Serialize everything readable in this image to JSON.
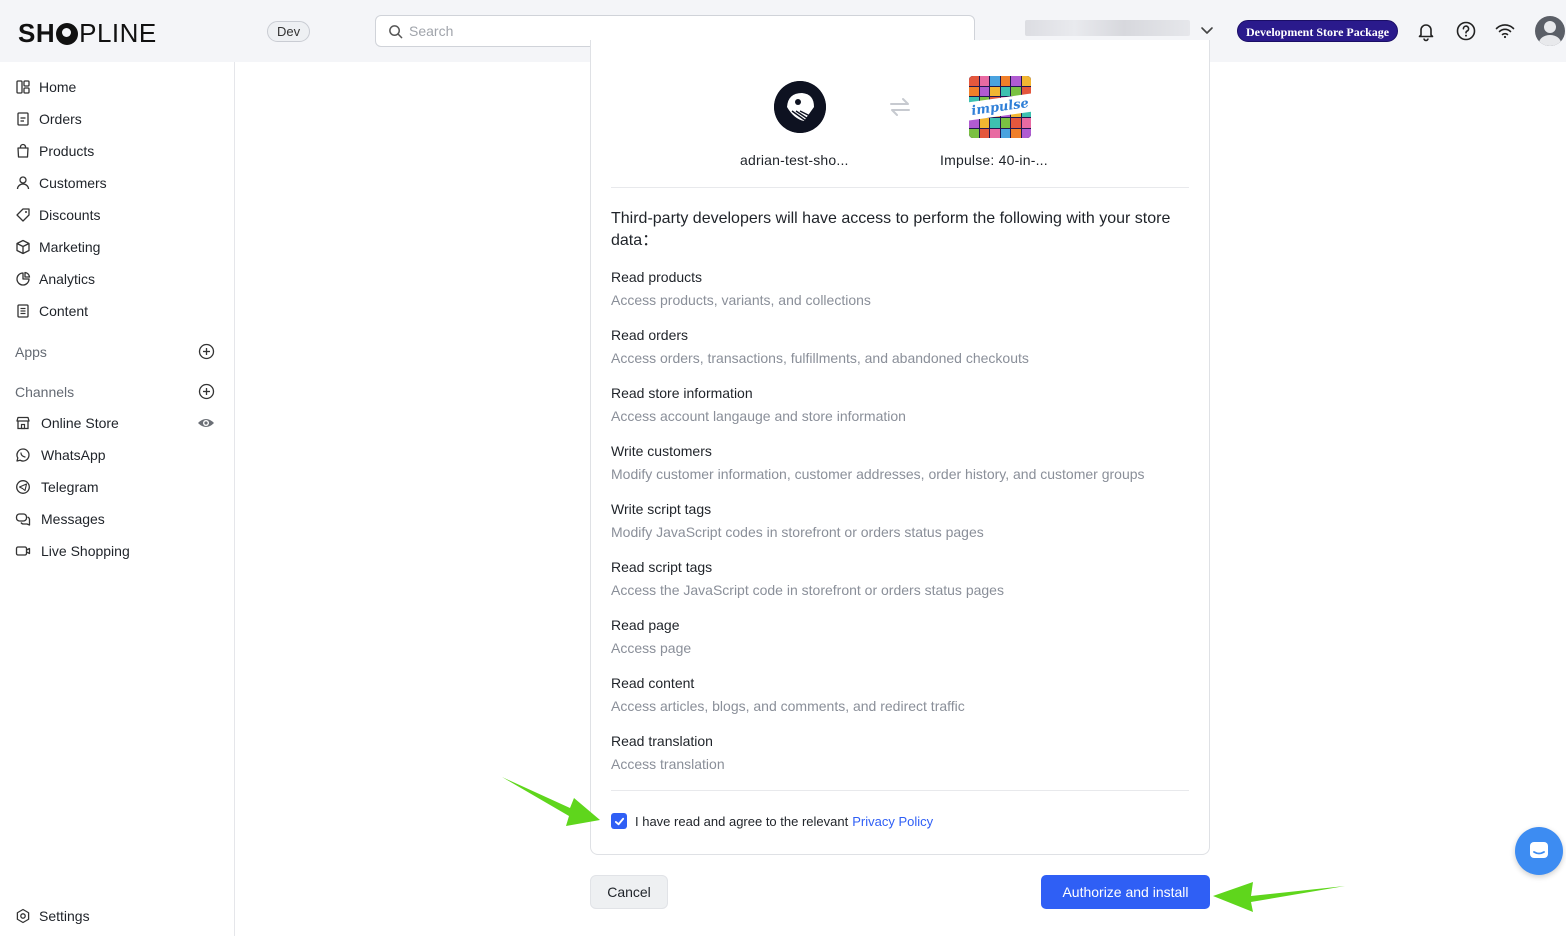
{
  "header": {
    "logo_bold": "SH",
    "logo_rest_bold": "PLINE",
    "env_badge": "Dev",
    "search_placeholder": "Search",
    "package_badge": "Development Store Package"
  },
  "sidebar": {
    "nav": [
      {
        "label": "Home",
        "icon": "home-icon"
      },
      {
        "label": "Orders",
        "icon": "orders-icon"
      },
      {
        "label": "Products",
        "icon": "shopping-bag-icon"
      },
      {
        "label": "Customers",
        "icon": "person-icon"
      },
      {
        "label": "Discounts",
        "icon": "tag-icon"
      },
      {
        "label": "Marketing",
        "icon": "cube-icon"
      },
      {
        "label": "Analytics",
        "icon": "pie-chart-icon"
      },
      {
        "label": "Content",
        "icon": "document-icon"
      }
    ],
    "apps_label": "Apps",
    "channels_label": "Channels",
    "channels": [
      {
        "label": "Online Store",
        "icon": "storefront-icon"
      },
      {
        "label": "WhatsApp",
        "icon": "whatsapp-icon"
      },
      {
        "label": "Telegram",
        "icon": "telegram-icon"
      },
      {
        "label": "Messages",
        "icon": "chat-bubbles-icon"
      },
      {
        "label": "Live Shopping",
        "icon": "video-icon"
      }
    ],
    "settings_label": "Settings"
  },
  "authorize": {
    "shop_name": "adrian-test-sho...",
    "app_name": "Impulse: 40-in-...",
    "app_logo_text": "impulse",
    "intro": "Third-party developers will have access to perform the following with your store data：",
    "permissions": [
      {
        "title": "Read products",
        "desc": "Access products, variants, and collections"
      },
      {
        "title": "Read orders",
        "desc": "Access orders, transactions, fulfillments, and abandoned checkouts"
      },
      {
        "title": "Read store information",
        "desc": "Access account langauge and store information"
      },
      {
        "title": "Write customers",
        "desc": "Modify customer information, customer addresses, order history, and customer groups"
      },
      {
        "title": "Write script tags",
        "desc": "Modify JavaScript codes in storefront or orders status pages"
      },
      {
        "title": "Read script tags",
        "desc": "Access the JavaScript code in storefront or orders status pages"
      },
      {
        "title": "Read page",
        "desc": "Access page"
      },
      {
        "title": "Read content",
        "desc": "Access articles, blogs, and comments, and redirect traffic"
      },
      {
        "title": "Read translation",
        "desc": "Access translation"
      }
    ],
    "agree_text": "I have read and agree to the relevant",
    "privacy_link": "Privacy Policy",
    "agree_checked": true,
    "cancel_label": "Cancel",
    "authorize_label": "Authorize and install"
  },
  "colors": {
    "primary": "#2f5ff5",
    "package_badge_bg": "#2a1a8c",
    "annotation_arrow": "#5fd61c"
  }
}
